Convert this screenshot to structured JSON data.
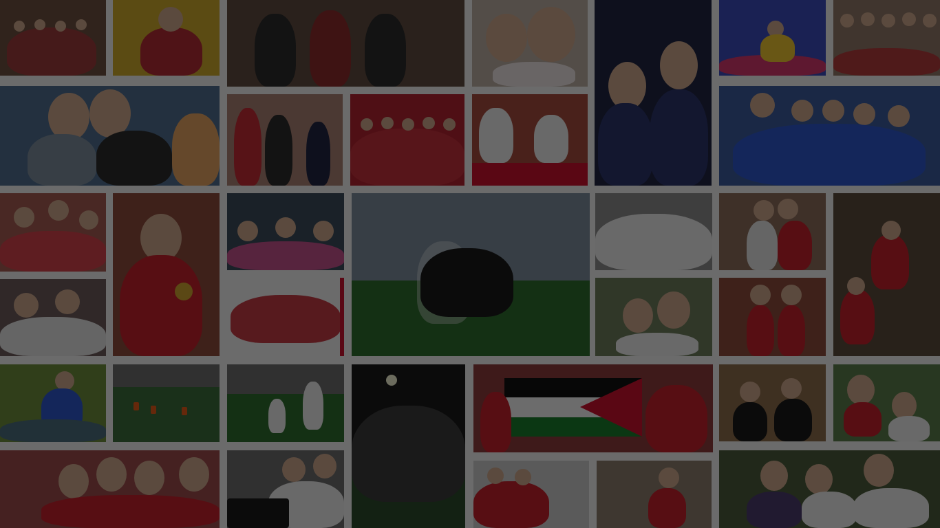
{
  "page": {
    "background": "#6b6b6b",
    "overlay": "rgba(0,0,0,0.55)",
    "accent": "#c8102e"
  },
  "mosaic": {
    "description_tiles": [
      {
        "id": "kids-classroom-group",
        "bg": "#6b4e3f"
      },
      {
        "id": "boy-on-slide",
        "bg": "#b59a2b"
      },
      {
        "id": "climbing-net",
        "bg": "#5d4a3e"
      },
      {
        "id": "girls-smiling",
        "bg": "#b9aaa0"
      },
      {
        "id": "graduates",
        "bg": "#1f2442"
      },
      {
        "id": "bouncy-castle",
        "bg": "#3b49b8"
      },
      {
        "id": "swimmers",
        "bg": "#8f7666"
      },
      {
        "id": "boys-hugging",
        "bg": "#4e6c8c"
      },
      {
        "id": "award-ceremony",
        "bg": "#a77f71"
      },
      {
        "id": "red-uniforms-stage",
        "bg": "#b0232f"
      },
      {
        "id": "martial-arts",
        "bg": "#a24a3c"
      },
      {
        "id": "robotics-team",
        "bg": "#3a5a99"
      },
      {
        "id": "girls-classroom",
        "bg": "#a35a50"
      },
      {
        "id": "boy-medal",
        "bg": "#8a4a3a"
      },
      {
        "id": "cheering-kids",
        "bg": "#3a4a5a"
      },
      {
        "id": "football-field-team",
        "bg": "#3a5a3a"
      },
      {
        "id": "gym-group-white",
        "bg": "#8b8b8b"
      },
      {
        "id": "boys-lunch",
        "bg": "#8a6a5a"
      },
      {
        "id": "climbing-frame",
        "bg": "#5a4a3a"
      },
      {
        "id": "girls-reading",
        "bg": "#6a5a5a"
      },
      {
        "id": "red-uniform-group",
        "bg": "#c03a44"
      },
      {
        "id": "kindergarten-girls",
        "bg": "#6a7a5a"
      },
      {
        "id": "costume-girls",
        "bg": "#8a4a3a"
      },
      {
        "id": "science-project",
        "bg": "#6a8a3a"
      },
      {
        "id": "cones-field",
        "bg": "#3b6a3b"
      },
      {
        "id": "kids-running-field",
        "bg": "#4a6a4a"
      },
      {
        "id": "night-football-team",
        "bg": "#1a1a1a"
      },
      {
        "id": "flag-group",
        "bg": "#8a3a3a"
      },
      {
        "id": "boys-vests",
        "bg": "#8a6a4a"
      },
      {
        "id": "girl-with-headband",
        "bg": "#5a7a4a"
      },
      {
        "id": "girls-waving",
        "bg": "#9a4a4a"
      },
      {
        "id": "piano-lesson",
        "bg": "#6a6a6a"
      },
      {
        "id": "red-shirts-kids",
        "bg": "#b04040"
      },
      {
        "id": "playground-boy",
        "bg": "#8a7a6a"
      },
      {
        "id": "stadium-friends",
        "bg": "#4a5a3a"
      }
    ]
  }
}
